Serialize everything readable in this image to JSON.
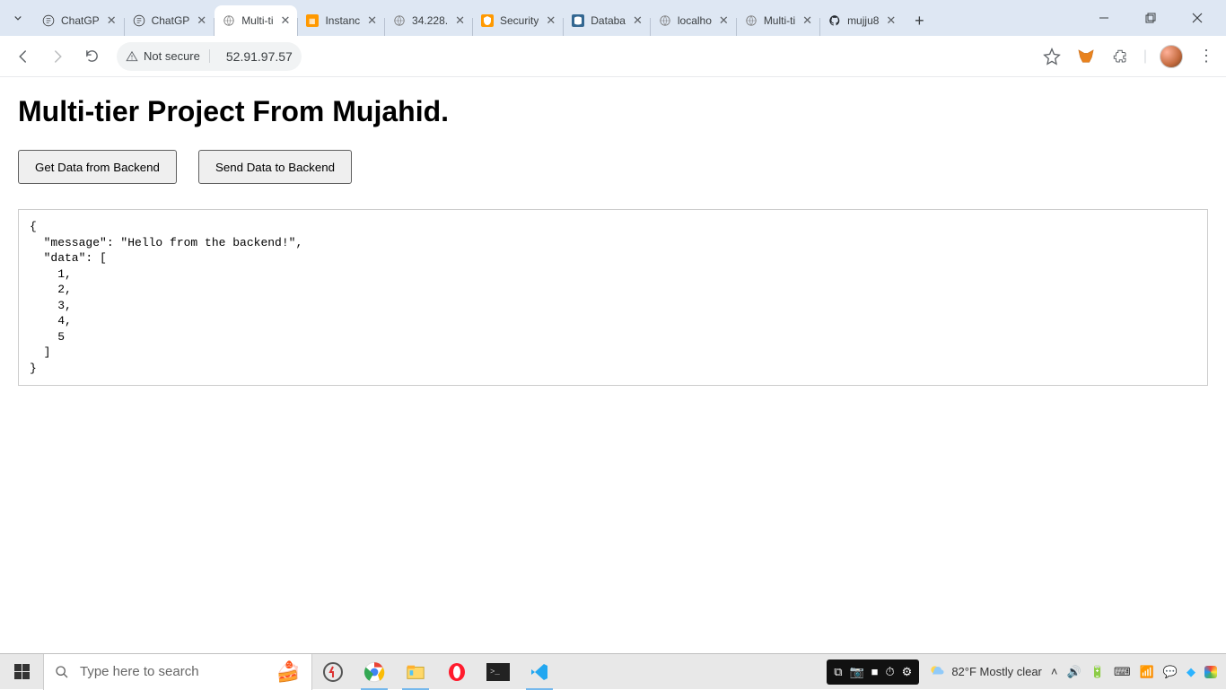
{
  "browser": {
    "tabs": [
      {
        "title": "ChatGP",
        "active": false,
        "icon": "chatgpt"
      },
      {
        "title": "ChatGP",
        "active": false,
        "icon": "chatgpt"
      },
      {
        "title": "Multi-ti",
        "active": true,
        "icon": "globe"
      },
      {
        "title": "Instanc",
        "active": false,
        "icon": "aws"
      },
      {
        "title": "34.228.",
        "active": false,
        "icon": "globe"
      },
      {
        "title": "Security",
        "active": false,
        "icon": "aws-sec"
      },
      {
        "title": "Databa",
        "active": false,
        "icon": "db"
      },
      {
        "title": "localho",
        "active": false,
        "icon": "globe"
      },
      {
        "title": "Multi-ti",
        "active": false,
        "icon": "globe"
      },
      {
        "title": "mujju8",
        "active": false,
        "icon": "github"
      }
    ],
    "security_label": "Not secure",
    "url": "52.91.97.57"
  },
  "page": {
    "heading": "Multi-tier Project From Mujahid.",
    "buttons": {
      "get": "Get Data from Backend",
      "send": "Send Data to Backend"
    },
    "output": "{\n  \"message\": \"Hello from the backend!\",\n  \"data\": [\n    1,\n    2,\n    3,\n    4,\n    5\n  ]\n}"
  },
  "taskbar": {
    "search_placeholder": "Type here to search",
    "weather": "82°F  Mostly clear"
  }
}
